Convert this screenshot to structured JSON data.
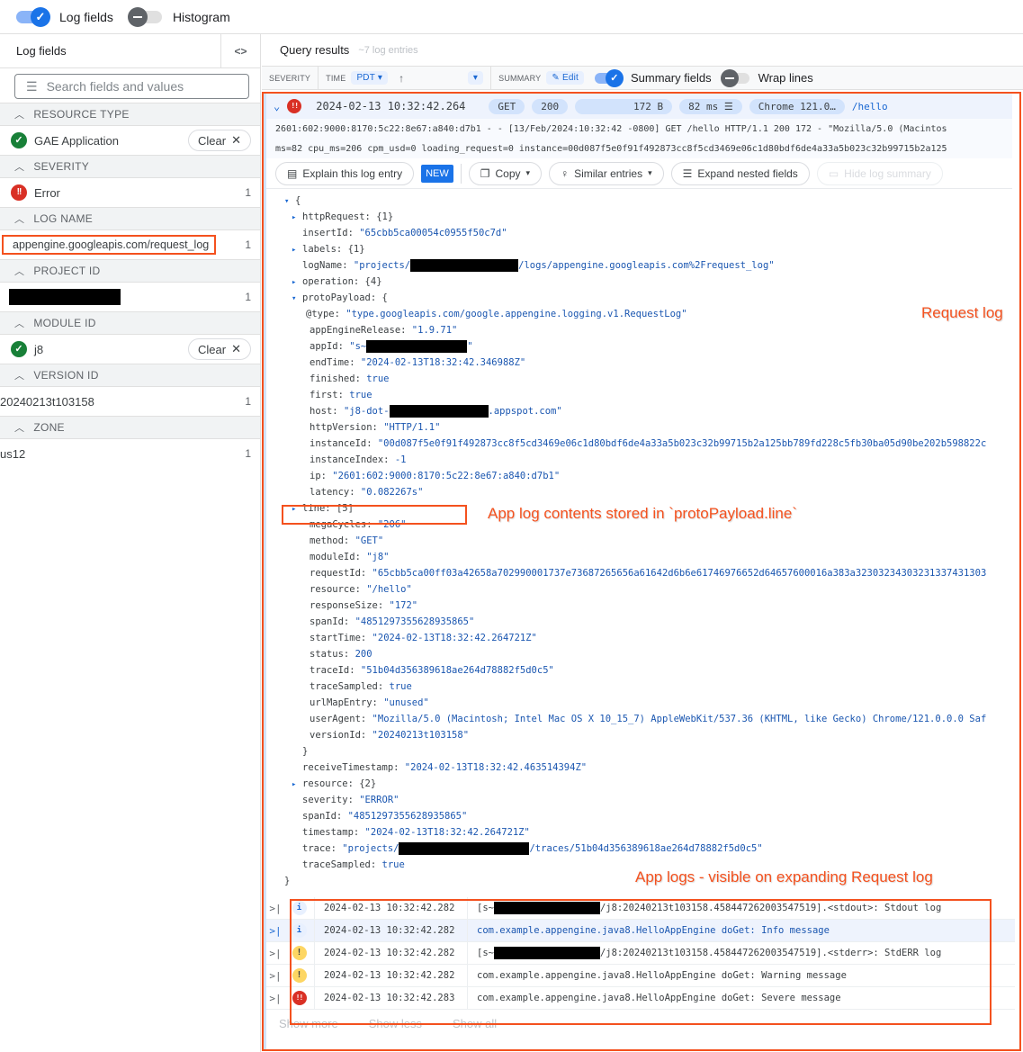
{
  "topbar": {
    "log_fields_toggle": "Log fields",
    "histogram_toggle": "Histogram"
  },
  "left_panel": {
    "title": "Log fields",
    "collapse_icon": "<>",
    "search_placeholder": "Search fields and values",
    "sections": [
      {
        "header": "RESOURCE TYPE",
        "value": "GAE Application",
        "icon": "check-circle-icon",
        "action": "Clear"
      },
      {
        "header": "SEVERITY",
        "value": "Error",
        "icon": "error-icon",
        "count": "1"
      },
      {
        "header": "LOG NAME",
        "value": "appengine.googleapis.com/request_log",
        "count": "1"
      },
      {
        "header": "PROJECT ID",
        "value": "[redacted]",
        "count": "1"
      },
      {
        "header": "MODULE ID",
        "value": "j8",
        "icon": "check-circle-icon",
        "action": "Clear"
      },
      {
        "header": "VERSION ID",
        "value": "20240213t103158",
        "count": "1"
      },
      {
        "header": "ZONE",
        "value": "us12",
        "count": "1"
      }
    ]
  },
  "results": {
    "title": "Query results",
    "subtitle": "~7 log entries",
    "columns": {
      "severity": "SEVERITY",
      "time": "TIME",
      "timezone": "PDT",
      "summary": "SUMMARY",
      "edit": "Edit",
      "summary_fields": "Summary fields",
      "wrap_lines": "Wrap lines"
    },
    "entry": {
      "timestamp": "2024-02-13 10:32:42.264",
      "method": "GET",
      "status": "200",
      "size": "172 B",
      "latency": "82 ms",
      "user_agent": "Chrome 121.0…",
      "path": "/hello",
      "summary_line1": "2601:602:9000:8170:5c22:8e67:a840:d7b1 - - [13/Feb/2024:10:32:42 -0800] GET /hello HTTP/1.1 200 172 - \"Mozilla/5.0 (Macintos",
      "summary_line2": "ms=82 cpu_ms=206 cpm_usd=0 loading_request=0 instance=00d087f5e0f91f492873cc8f5cd3469e06c1d80bdf6de4a33a5b023c32b99715b2a125",
      "actions": {
        "explain": "Explain this log entry",
        "new_badge": "NEW",
        "copy": "Copy",
        "similar": "Similar entries",
        "expand": "Expand nested fields",
        "hide": "Hide log summary"
      }
    },
    "json_lines": [
      {
        "ind": "ind0",
        "arrow": "▾",
        "key": "{",
        "val": ""
      },
      {
        "ind": "ind1",
        "arrow": "▸",
        "key": "httpRequest: ",
        "val": "{1}",
        "plain": true
      },
      {
        "ind": "ind1n",
        "key": "insertId: ",
        "val": "\"65cbb5ca00054c0955f50c7d\""
      },
      {
        "ind": "ind1",
        "arrow": "▸",
        "key": "labels: ",
        "val": "{1}",
        "plain": true
      },
      {
        "ind": "ind1n",
        "key": "logName: ",
        "val": "\"projects/",
        "redact": 120,
        "val2": "/logs/appengine.googleapis.com%2Frequest_log\""
      },
      {
        "ind": "ind1",
        "arrow": "▸",
        "key": "operation: ",
        "val": "{4}",
        "plain": true
      },
      {
        "ind": "ind1",
        "arrow": "▾",
        "key": "protoPayload: {",
        "val": ""
      },
      {
        "ind": "ind2b",
        "key": "@type: ",
        "val": "\"type.googleapis.com/google.appengine.logging.v1.RequestLog\""
      },
      {
        "ind": "ind2",
        "key": "appEngineRelease: ",
        "val": "\"1.9.71\""
      },
      {
        "ind": "ind2",
        "key": "appId: ",
        "val": "\"s~",
        "redact": 112,
        "val2": "\""
      },
      {
        "ind": "ind2",
        "key": "endTime: ",
        "val": "\"2024-02-13T18:32:42.346988Z\""
      },
      {
        "ind": "ind2",
        "key": "finished: ",
        "val": "true"
      },
      {
        "ind": "ind2",
        "key": "first: ",
        "val": "true"
      },
      {
        "ind": "ind2",
        "key": "host: ",
        "val": "\"j8-dot-",
        "redact": 110,
        "val2": ".appspot.com\""
      },
      {
        "ind": "ind2",
        "key": "httpVersion: ",
        "val": "\"HTTP/1.1\""
      },
      {
        "ind": "ind2",
        "key": "instanceId: ",
        "val": "\"00d087f5e0f91f492873cc8f5cd3469e06c1d80bdf6de4a33a5b023c32b99715b2a125bb789fd228c5fb30ba05d90be202b598822c"
      },
      {
        "ind": "ind2",
        "key": "instanceIndex: ",
        "val": "-1"
      },
      {
        "ind": "ind2",
        "key": "ip: ",
        "val": "\"2601:602:9000:8170:5c22:8e67:a840:d7b1\""
      },
      {
        "ind": "ind2",
        "key": "latency: ",
        "val": "\"0.082267s\""
      },
      {
        "ind": "ind1",
        "arrow": "▸",
        "key": "line: ",
        "val": "[5]",
        "plain": true,
        "pad": true
      },
      {
        "ind": "ind2",
        "key": "megaCycles: ",
        "val": "\"206\""
      },
      {
        "ind": "ind2",
        "key": "method: ",
        "val": "\"GET\""
      },
      {
        "ind": "ind2",
        "key": "moduleId: ",
        "val": "\"j8\""
      },
      {
        "ind": "ind2",
        "key": "requestId: ",
        "val": "\"65cbb5ca00ff03a42658a702990001737e73687265656a61642d6b6e61746976652d64657600016a383a32303234303231337431303"
      },
      {
        "ind": "ind2",
        "key": "resource: ",
        "val": "\"/hello\""
      },
      {
        "ind": "ind2",
        "key": "responseSize: ",
        "val": "\"172\""
      },
      {
        "ind": "ind2",
        "key": "spanId: ",
        "val": "\"4851297355628935865\""
      },
      {
        "ind": "ind2",
        "key": "startTime: ",
        "val": "\"2024-02-13T18:32:42.264721Z\""
      },
      {
        "ind": "ind2",
        "key": "status: ",
        "val": "200"
      },
      {
        "ind": "ind2",
        "key": "traceId: ",
        "val": "\"51b04d356389618ae264d78882f5d0c5\""
      },
      {
        "ind": "ind2",
        "key": "traceSampled: ",
        "val": "true"
      },
      {
        "ind": "ind2",
        "key": "urlMapEntry: ",
        "val": "\"unused\""
      },
      {
        "ind": "ind2",
        "key": "userAgent: ",
        "val": "\"Mozilla/5.0 (Macintosh; Intel Mac OS X 10_15_7) AppleWebKit/537.36 (KHTML, like Gecko) Chrome/121.0.0.0 Saf"
      },
      {
        "ind": "ind2",
        "key": "versionId: ",
        "val": "\"20240213t103158\""
      },
      {
        "ind": "ind1n",
        "key": "}",
        "val": ""
      },
      {
        "ind": "ind1n",
        "key": "receiveTimestamp: ",
        "val": "\"2024-02-13T18:32:42.463514394Z\""
      },
      {
        "ind": "ind1",
        "arrow": "▸",
        "key": "resource: ",
        "val": "{2}",
        "plain": true
      },
      {
        "ind": "ind1n",
        "key": "severity: ",
        "val": "\"ERROR\""
      },
      {
        "ind": "ind1n",
        "key": "spanId: ",
        "val": "\"4851297355628935865\""
      },
      {
        "ind": "ind1n",
        "key": "timestamp: ",
        "val": "\"2024-02-13T18:32:42.264721Z\""
      },
      {
        "ind": "ind1n",
        "key": "trace: ",
        "val": "\"projects/",
        "redact": 145,
        "val2": "/traces/51b04d356389618ae264d78882f5d0c5\""
      },
      {
        "ind": "ind1n",
        "key": "traceSampled: ",
        "val": "true"
      },
      {
        "ind": "ind0",
        "key": "  }",
        "val": ""
      }
    ],
    "app_logs": [
      {
        "sev": "info",
        "ts": "2024-02-13 10:32:42.282",
        "pre": "[s~",
        "redact": 118,
        "msg": "/j8:20240213t103158.458447262003547519].<stdout>: Stdout log"
      },
      {
        "sev": "info",
        "ts": "2024-02-13 10:32:42.282",
        "msg": "com.example.appengine.java8.HelloAppEngine doGet: Info message",
        "hl": true
      },
      {
        "sev": "warning",
        "ts": "2024-02-13 10:32:42.282",
        "pre": "[s~",
        "redact": 118,
        "msg": "/j8:20240213t103158.458447262003547519].<stderr>: StdERR log"
      },
      {
        "sev": "warning",
        "ts": "2024-02-13 10:32:42.282",
        "msg": "com.example.appengine.java8.HelloAppEngine doGet: Warning message"
      },
      {
        "sev": "error",
        "ts": "2024-02-13 10:32:42.283",
        "msg": "com.example.appengine.java8.HelloAppEngine doGet: Severe message"
      }
    ],
    "show_more": "Show more",
    "show_less": "Show less",
    "show_all": "Show all"
  },
  "annotations": {
    "request_log": "Request log",
    "line_note": "App log contents stored in `protoPayload.line`",
    "app_logs_note": "App logs - visible on expanding Request log"
  },
  "colors": {
    "annotation": "#f4511e",
    "error": "#d93025",
    "success": "#188038",
    "warning": "#fdd663",
    "accent": "#1a73e8"
  }
}
